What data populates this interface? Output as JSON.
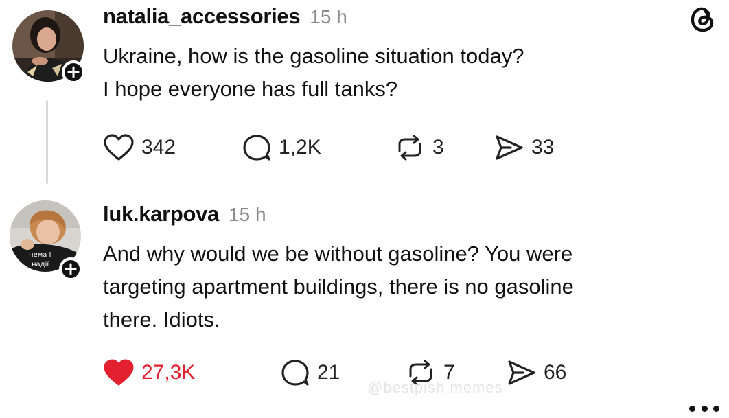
{
  "app": {
    "logo_icon": "threads-logo-icon",
    "watermark": "@bestpish memes"
  },
  "posts": [
    {
      "username": "natalia_accessories",
      "time": "15 h",
      "lines": [
        "Ukraine, how is the gasoline situation today?",
        "I hope everyone has full tanks?"
      ],
      "likes": "342",
      "liked": false,
      "comments": "1,2K",
      "reposts": "3",
      "shares": "33"
    },
    {
      "username": "luk.karpova",
      "time": "15 h",
      "lines": [
        "And why would we be without gasoline? You were",
        "targeting apartment buildings, there is no gasoline",
        "there. Idiots."
      ],
      "avatar_text": [
        "нема І",
        "надії"
      ],
      "likes": "27,3K",
      "liked": true,
      "comments": "21",
      "reposts": "7",
      "shares": "66"
    }
  ],
  "colors": {
    "liked": "#e3202f",
    "muted": "#8a8a8a",
    "text": "#111111"
  }
}
